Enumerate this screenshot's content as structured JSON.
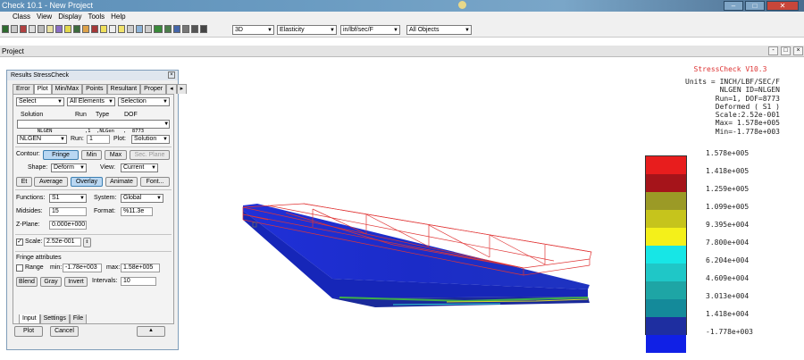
{
  "window": {
    "title": "Check 10.1 - New Project",
    "buttons": [
      "–",
      "□",
      "✕"
    ]
  },
  "menu": [
    "Class",
    "View",
    "Display",
    "Tools",
    "Help"
  ],
  "toolbar": {
    "view_select": "3D",
    "material_select": "Elasticity",
    "units_select": "in/lbf/sec/F",
    "objects_select": "All Objects"
  },
  "project_bar": {
    "title": "Project",
    "buttons": [
      "-",
      "□",
      "×"
    ]
  },
  "results_panel": {
    "title": "Results StressCheck",
    "close": "×",
    "tabs": [
      "Error",
      "Plot",
      "Min/Max",
      "Points",
      "Resultant",
      "Proper",
      "◂",
      "▸"
    ],
    "active_tab": "Plot",
    "select1": "Select",
    "select2": "All Elements",
    "select3": "Selection",
    "solution_headers": [
      "Solution",
      "Run",
      "Type",
      "DOF"
    ],
    "solution_row": "NLGEN           ,1  ,NLGen   ,  8773",
    "solution_label": "NLGEN",
    "run_label": "Run:",
    "run_value": "1",
    "plot_label": "Plot:",
    "plot_value": "Solution",
    "contour_label": "Contour:",
    "fringe_btn": "Fringe",
    "min_btn": "Min",
    "max_btn": "Max",
    "sec_plane_btn": "Sec. Plane",
    "shape_label": "Shape:",
    "shape_value": "Deform",
    "view_label": "View:",
    "view_value": "Current",
    "et_btn": "Et",
    "average_btn": "Average",
    "overlay_btn": "Overlay",
    "animate_btn": "Animate",
    "font_btn": "Font...",
    "functions_label": "Functions:",
    "functions_value": "S1",
    "system_label": "System:",
    "system_value": "Global",
    "midsides_label": "Midsides:",
    "midsides_value": "15",
    "format_label": "Format:",
    "format_value": "%11.3e",
    "zplane_label": "Z-Plane:",
    "zplane_value": "0.000e+000",
    "scale_label": "Scale:",
    "scale_value": "2.52e-001",
    "fringe_attr_label": "Fringe attributes",
    "range_label": "Range",
    "min_label": "min:",
    "min_value": "-1.78e+003",
    "max_label": "max:",
    "max_value": "1.58e+005",
    "blend_btn": "Blend",
    "gray_btn": "Gray",
    "invert_btn": "Invert",
    "intervals_label": "Intervals:",
    "intervals_value": "10",
    "bottom_tabs": [
      "Input",
      "Settings",
      "File"
    ],
    "plot_btn": "Plot",
    "cancel_btn": "Cancel",
    "up_btn": "▲"
  },
  "info": {
    "title": "StressCheck V10.3",
    "lines": "Units = INCH/LBF/SEC/F\n NLGEN ID=NLGEN\n Run=1, DOF=8773\n Deformed ( S1 )\n Scale:2.52e-001\n Max= 1.578e+005\n Min=-1.778e+003"
  },
  "legend": {
    "colors": [
      "#e81d1d",
      "#a5141a",
      "#9b9a26",
      "#c6c41c",
      "#f4f01a",
      "#17e6e6",
      "#1fc7c7",
      "#1ea5a5",
      "#148a9a",
      "#1e2ea0",
      "#1020e6"
    ],
    "values": [
      "1.578e+005",
      "1.418e+005",
      "1.259e+005",
      "1.099e+005",
      "9.395e+004",
      "7.800e+004",
      "6.204e+004",
      "4.609e+004",
      "3.013e+004",
      "1.418e+004",
      "-1.778e+003"
    ]
  }
}
